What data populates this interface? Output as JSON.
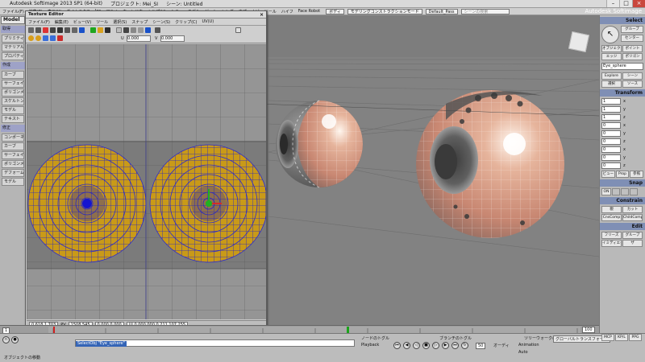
{
  "app": {
    "title": "Autodesk Softimage 2013 SP1 (64-bit)",
    "project": "プロジェクト: Mei_SI",
    "scene": "シーン: Untitled",
    "brand": "Autodesk Softimage"
  },
  "menubar": {
    "items": [
      "ファイル(F)",
      "編集(E)",
      "表示(V)",
      "ダイナミクス",
      "Ice",
      "アニメ",
      "ウィンドウ",
      "ヘルプ(H)",
      "シミュ",
      "モデル",
      "ゲーム",
      "レンダ",
      "オプ",
      "ナビ",
      "ツール",
      "ハイフ",
      "Face Robot"
    ],
    "mode_combo": "ボディ",
    "construction_combo": "モデリングコンストラクションモード",
    "pass_combo": "Default_Pass",
    "search_placeholder": "シーンの検索"
  },
  "left_panel": {
    "tab": "Model",
    "sections": [
      {
        "head": "取得",
        "items": [
          "プリミティ",
          "マテリアル",
          "プロパティ"
        ]
      },
      {
        "head": "作成",
        "items": [
          "カーブ",
          "サーフェイス",
          "ポリゴンメ",
          "スケルトン",
          "モデル",
          "テキスト"
        ]
      },
      {
        "head": "修正",
        "items": [
          "コンポーネ",
          "カーブ",
          "サーフェイス",
          "ポリゴンメ",
          "デフォーム",
          "モデル"
        ]
      }
    ]
  },
  "texture_editor": {
    "title": "Texture Editor",
    "menu": [
      "ファイル(F)",
      "編集(E)",
      "ビュー(V)",
      "ツール",
      "選択(S)",
      "スナップ",
      "シーン(S)",
      "クリップ(C)",
      "UV(U)"
    ],
    "status": {
      "uv": "0.618  1.703",
      "pv_label": "PV",
      "pv": "1508  545",
      "range": "0.000  0.000",
      "ui": "UI  0.000  000.0  211  107  255"
    },
    "toolbar_values": {
      "u": "U",
      "v": "V",
      "val1": "0.000",
      "val2": "0.000"
    }
  },
  "viewport": {
    "label": "Viewport"
  },
  "right_panel": {
    "select_head": "Select",
    "select_buttons": [
      "グループ",
      "センター",
      "オブジェクト",
      "ポイント",
      "エッジ",
      "ポリゴン"
    ],
    "object_name": "Eye_sphere",
    "explore_buttons": [
      "Explore",
      "シーン",
      "選択",
      "ソース"
    ],
    "transform_head": "Transform",
    "scale": [
      "1",
      "1",
      "1"
    ],
    "rotate": [
      "0",
      "0",
      "0"
    ],
    "translate": [
      "0",
      "0",
      "0"
    ],
    "axis_labels": [
      "x",
      "y",
      "z"
    ],
    "view_buttons": [
      "ビュー",
      "Prop",
      "参照"
    ],
    "snap_head": "Snap",
    "snap_on": "ON",
    "constrain_head": "Constrain",
    "constrain_buttons": [
      "親",
      "カット",
      "CnsComp",
      "ChildComp"
    ],
    "edit_head": "Edit",
    "edit_buttons": [
      "フリーズ",
      "グループ",
      "イミディエイト",
      "ザ"
    ],
    "footer_tabs": [
      "MCP",
      "KP/L",
      "PPG"
    ]
  },
  "timeline": {
    "start": "1",
    "end": "100",
    "current": "100",
    "markers": [
      "1",
      "10",
      "20",
      "30",
      "40",
      "50",
      "60",
      "70",
      "80",
      "90",
      "100"
    ]
  },
  "statusbar": {
    "command": "SelectObj \"Eye_sphere\"",
    "message": "オブジェクトの移動",
    "playback_label": "Playback",
    "animation_label": "Animation",
    "frame": "50",
    "fps_label": "オーディ",
    "auto_label": "Auto",
    "node_label": "ノードのトグル",
    "branch_label": "ブランチのトグル",
    "treewalk_label": "ツリーウォークのトグル",
    "kinematic_combo": "グローバルトランスフォーム"
  },
  "colors": {
    "viewport_bg": "#7d7d7d",
    "panel_header": "#7f8fb5",
    "uv_yellow": "#c99a18",
    "uv_blue": "#1e1ed2",
    "skin": "#d9a189",
    "selection_blue": "#3464b6"
  }
}
